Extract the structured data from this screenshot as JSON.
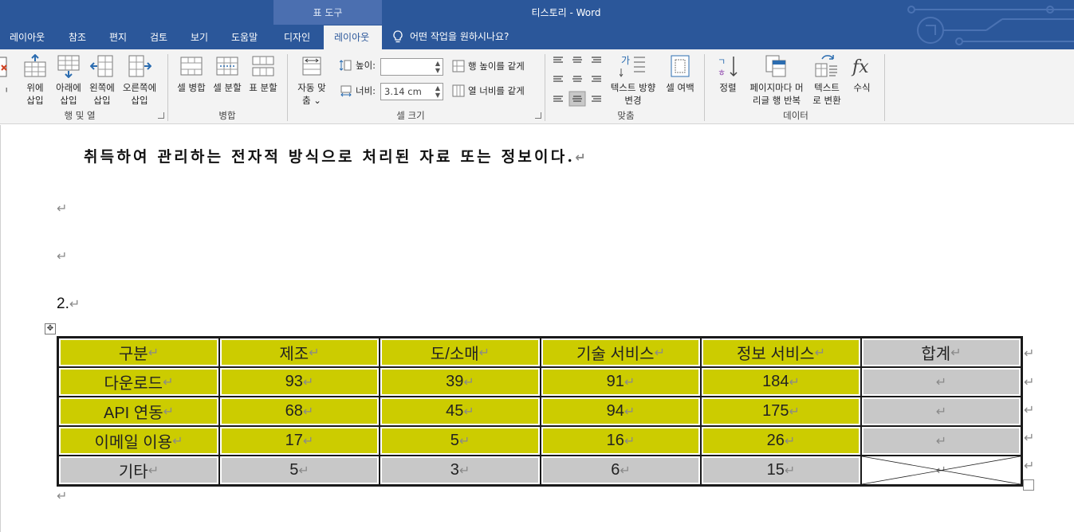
{
  "window": {
    "context_tab_group": "표 도구",
    "title": "티스토리  -  Word"
  },
  "tabs": [
    {
      "label": "레이아웃"
    },
    {
      "label": "참조"
    },
    {
      "label": "편지"
    },
    {
      "label": "검토"
    },
    {
      "label": "보기"
    },
    {
      "label": "도움말"
    },
    {
      "label": "디자인"
    },
    {
      "label": "레이아웃",
      "active": true
    }
  ],
  "tell_me": "어떤 작업을 원하시나요?",
  "ribbon": {
    "rows_cols": {
      "group_label": "행 및 열",
      "buttons": [
        {
          "line1": "위에",
          "line2": "삽입"
        },
        {
          "line1": "아래에",
          "line2": "삽입"
        },
        {
          "line1": "왼쪽에",
          "line2": "삽입"
        },
        {
          "line1": "오른쪽에",
          "line2": "삽입"
        }
      ]
    },
    "merge": {
      "group_label": "병합",
      "buttons": [
        "셀 병합",
        "셀 분할",
        "표 분할"
      ]
    },
    "cell_size": {
      "group_label": "셀 크기",
      "autofit_line1": "자동 맞",
      "autofit_line2": "춤 ⌄",
      "height_label": "높이:",
      "height_value": "",
      "width_label": "너비:",
      "width_value": "3.14 cm",
      "distribute_rows": "행 높이를 같게",
      "distribute_cols": "열 너비를 같게"
    },
    "alignment": {
      "group_label": "맞춤",
      "text_direction_line1": "텍스트 방향",
      "text_direction_line2": "변경",
      "cell_margins": "셀 여백"
    },
    "data": {
      "group_label": "데이터",
      "sort": "정렬",
      "repeat_line1": "페이지마다 머",
      "repeat_line2": "리글 행 반복",
      "convert_line1": "텍스트",
      "convert_line2": "로 변환",
      "formula": "수식"
    }
  },
  "document": {
    "body_line": "취득하여 관리하는 전자적 방식으로 처리된 자료 또는 정보이다.",
    "paragraph_mark": "↵",
    "heading": "2.",
    "move_handle_glyph": "✥"
  },
  "table": {
    "colors": {
      "highlight": "#cccc00",
      "gray": "#c8c8c8"
    },
    "header": [
      "구분",
      "제조",
      "도/소매",
      "기술 서비스",
      "정보 서비스",
      "합계"
    ],
    "rows": [
      [
        "다운로드",
        "93",
        "39",
        "91",
        "184",
        ""
      ],
      [
        "API 연동",
        "68",
        "45",
        "94",
        "175",
        ""
      ],
      [
        "이메일 이용",
        "17",
        "5",
        "16",
        "26",
        ""
      ],
      [
        "기타",
        "5",
        "3",
        "6",
        "15",
        ""
      ]
    ]
  }
}
